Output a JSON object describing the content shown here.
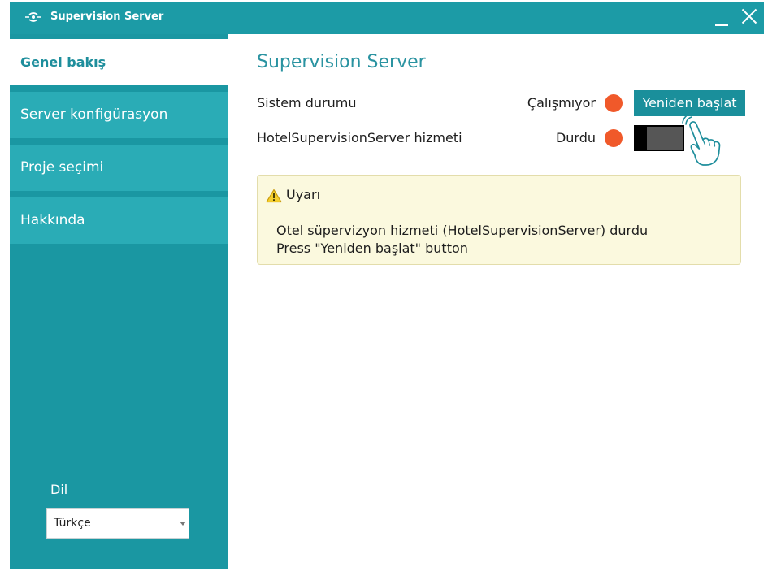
{
  "window": {
    "title": "Supervision Server",
    "logo_icon": "supervision-logo-icon",
    "minimize_icon": "minimize-icon",
    "close_icon": "close-icon"
  },
  "sidebar": {
    "items": [
      {
        "label": "Genel bakış",
        "selected": true
      },
      {
        "label": "Server konfigürasyon",
        "selected": false
      },
      {
        "label": "Proje seçimi",
        "selected": false
      },
      {
        "label": "Hakkında",
        "selected": false
      }
    ],
    "language": {
      "label": "Dil",
      "selected": "Türkçe",
      "dropdown_icon": "chevron-down-icon"
    }
  },
  "main": {
    "title": "Supervision Server",
    "status_rows": [
      {
        "label": "Sistem durumu",
        "value": "Çalışmıyor",
        "indicator_color": "#f0592a",
        "button_label": "Yeniden başlat"
      },
      {
        "label": "HotelSupervisionServer hizmeti",
        "value": "Durdu",
        "indicator_color": "#f0592a",
        "toggle_on": false
      }
    ],
    "tap_hint_icon": "hand-pointer-icon",
    "warning": {
      "icon": "warning-icon",
      "title": "Uyarı",
      "lines": [
        "Otel süpervizyon hizmeti (HotelSupervisionServer) durdu",
        "Press \"Yeniden başlat\" button"
      ]
    }
  },
  "colors": {
    "titlebar": "#1c9ba6",
    "sidebar": "#1a97a2",
    "nav-item": "#2aacb6",
    "accent-text": "#1e8e9c",
    "heading": "#2a93a1",
    "button": "#1a8f9b",
    "warning-bg": "#fbf9de",
    "warning-border": "#e3ddab"
  }
}
